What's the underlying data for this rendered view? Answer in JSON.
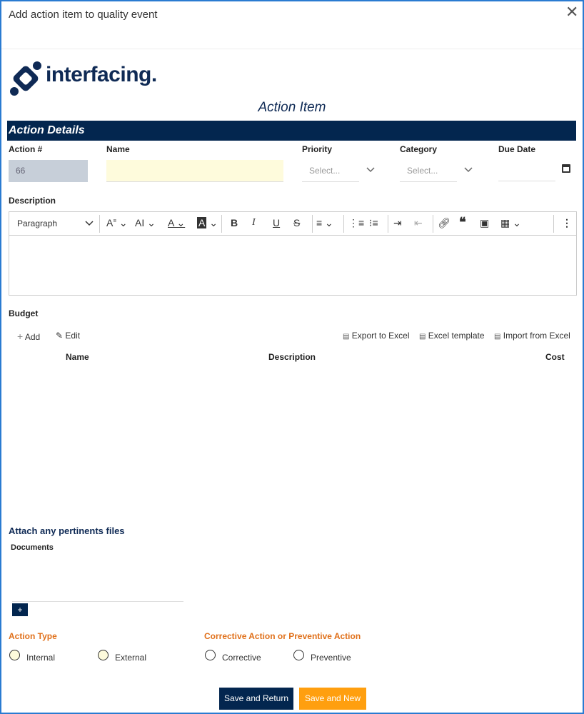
{
  "dialog": {
    "title": "Add action item to quality event"
  },
  "logo": {
    "text": "interfacing."
  },
  "form": {
    "title": "Action Item"
  },
  "details": {
    "section_title": "Action Details",
    "action_no": {
      "label": "Action #",
      "value": "66"
    },
    "name": {
      "label": "Name",
      "value": ""
    },
    "priority": {
      "label": "Priority",
      "placeholder": "Select..."
    },
    "category": {
      "label": "Category",
      "placeholder": "Select..."
    },
    "due_date": {
      "label": "Due Date",
      "value": ""
    }
  },
  "description": {
    "label": "Description",
    "toolbar": {
      "heading_select": "Paragraph",
      "font_size": "A",
      "font_family": "AI",
      "font_color": "A",
      "highlight": "A",
      "bold": "B",
      "italic": "I",
      "underline": "U",
      "strike": "S"
    }
  },
  "budget": {
    "label": "Budget",
    "add": "Add",
    "edit": "Edit",
    "export": "Export to Excel",
    "template": "Excel template",
    "import": "Import from Excel",
    "columns": [
      "Name",
      "Description",
      "Cost"
    ]
  },
  "attachments": {
    "title": "Attach any pertinents files",
    "documents_label": "Documents"
  },
  "action_type": {
    "label": "Action Type",
    "options": [
      "Internal",
      "External"
    ]
  },
  "cap": {
    "label": "Corrective Action or Preventive Action",
    "options": [
      "Corrective",
      "Preventive"
    ]
  },
  "buttons": {
    "save_return": "Save and Return",
    "save_new": "Save and New"
  },
  "colors": {
    "navy": "#03264f",
    "orange": "#ff9f0f",
    "accent_text": "#e0701a",
    "name_field_bg": "#fefbdc",
    "border": "#2a7bd1"
  }
}
